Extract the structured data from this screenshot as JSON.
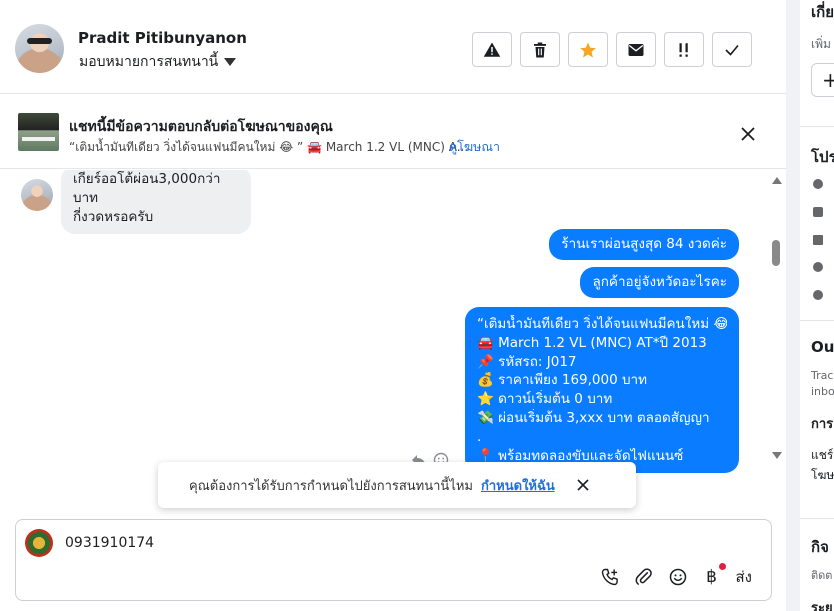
{
  "header": {
    "contact_name": "Pradit Pitibunyanon",
    "assign_label": "มอบหมายการสนทนานี้",
    "toolbar": [
      {
        "name": "alert-button",
        "icon": "warning-icon"
      },
      {
        "name": "delete-button",
        "icon": "trash-icon"
      },
      {
        "name": "star-button",
        "icon": "star-icon",
        "color": "#f5a623"
      },
      {
        "name": "mark-unread-button",
        "icon": "envelope-icon"
      },
      {
        "name": "follow-up-button",
        "icon": "double-exclamation-icon"
      },
      {
        "name": "done-button",
        "icon": "check-icon"
      }
    ]
  },
  "ad_banner": {
    "title": "แชทนี้มีข้อความตอบกลับต่อโฆษณาของคุณ",
    "subtitle": "“เติมน้ำมันทีเดียว วิ่งได้จนแฟนมีคนใหม่ 😂 ” 🚘 March 1.2 VL (MNC) A...",
    "link": "ดูโฆษณา"
  },
  "conversation": {
    "incoming": [
      "เกียร์ออโต้ผ่อน3,000กว่าบาท",
      "กี่งวดหรอครับ"
    ],
    "outgoing": [
      "ร้านเราผ่อนสูงสุด 84 งวดค่ะ",
      "ลูกค้าอยู่จังหวัดอะไรคะ"
    ],
    "ad_reply_lines": [
      "“เติมน้ำมันทีเดียว วิ่งได้จนแฟนมีคนใหม่ 😂”",
      "🚘 March 1.2 VL (MNC) AT*ปี 2013",
      "📌 รหัสรถ: J017",
      "💰 ราคาเพียง 169,000 บาท",
      "⭐ ดาวน์เริ่มต้น 0 บาท",
      "💸 ผ่อนเริ่มต้น 3,xxx บาท ตลอดสัญญา",
      ".",
      "📍 พร้อมทดลองขับและจัดไฟแนนซ์"
    ]
  },
  "toast": {
    "text": "คุณต้องการได้รับการกำหนดไปยังการสนทนานี้ไหม",
    "action": "กำหนดให้ฉัน"
  },
  "composer": {
    "value": "0931910174",
    "send_label": "ส่ง",
    "currency_symbol": "฿"
  },
  "right_panel": {
    "top_heading": "เกี่ย",
    "add_sub": "เพิ่ม",
    "add_symbol": "+",
    "profile_heading": "โปร",
    "outcome_heading": "Ou",
    "outcome_sub1": "Trac",
    "outcome_sub2": "inbo",
    "section_heading": "การ",
    "share_text1": "แชร์",
    "share_text2": "โฆษ",
    "activity_heading": "กิจ",
    "activity_sub": "ติดต",
    "bottom_heading": "ระย"
  },
  "colors": {
    "outgoing_bubble": "#0a7cff",
    "incoming_bubble": "#eeeff1",
    "link": "#216fdb",
    "star": "#f5a623",
    "notification_dot": "#e41e3f"
  }
}
